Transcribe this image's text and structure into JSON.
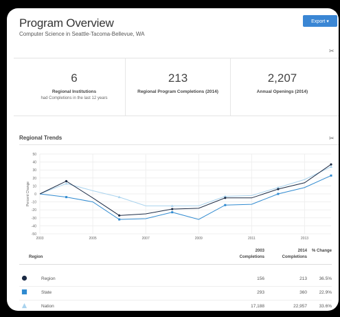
{
  "header": {
    "title": "Program Overview",
    "subtitle": "Computer Science in Seattle-Tacoma-Bellevue, WA",
    "export_label": "Export ▾"
  },
  "stats": [
    {
      "value": "6",
      "label": "Regional Institutions",
      "sub": "had Completions in the last 12 years"
    },
    {
      "value": "213",
      "label": "Regional Program Completions (2014)",
      "sub": ""
    },
    {
      "value": "2,207",
      "label": "Annual Openings (2014)",
      "sub": ""
    }
  ],
  "trends": {
    "title": "Regional Trends"
  },
  "colors": {
    "region": "#1b2a44",
    "state": "#2f8ad0",
    "nation": "#a9d3ee",
    "accent": "#3a86d4"
  },
  "chart_data": {
    "type": "line",
    "ylabel": "Percent Change",
    "ylim": [
      -50,
      50
    ],
    "yticks": [
      "50",
      "40",
      "30",
      "20",
      "10",
      "0",
      "-10",
      "-20",
      "-30",
      "-40",
      "-50"
    ],
    "x": [
      2003,
      2004,
      2005,
      2006,
      2007,
      2008,
      2009,
      2010,
      2011,
      2012,
      2013,
      2014
    ],
    "xtick_labels": [
      "2003",
      "2005",
      "2007",
      "2009",
      "2011",
      "2013"
    ],
    "series": [
      {
        "name": "Region",
        "values": [
          0,
          16,
          -5,
          -27,
          -25,
          -19,
          -18,
          -5,
          -5,
          6,
          14,
          37
        ]
      },
      {
        "name": "State",
        "values": [
          0,
          -4,
          -10,
          -32,
          -31,
          -23,
          -32,
          -14,
          -13,
          0,
          8,
          23
        ]
      },
      {
        "name": "Nation",
        "values": [
          0,
          13,
          4,
          -4,
          -15,
          -15,
          -15,
          -3,
          -2,
          8,
          18,
          34
        ]
      }
    ]
  },
  "table": {
    "headers": {
      "region": "Region",
      "c2003": "2003 Completions",
      "c2014": "2014 Completions",
      "change": "% Change"
    },
    "rows": [
      {
        "name": "Region",
        "c2003": "156",
        "c2014": "213",
        "change": "36.5%"
      },
      {
        "name": "State",
        "c2003": "293",
        "c2014": "360",
        "change": "22.9%"
      },
      {
        "name": "Nation",
        "c2003": "17,188",
        "c2014": "22,957",
        "change": "33.6%"
      }
    ]
  }
}
